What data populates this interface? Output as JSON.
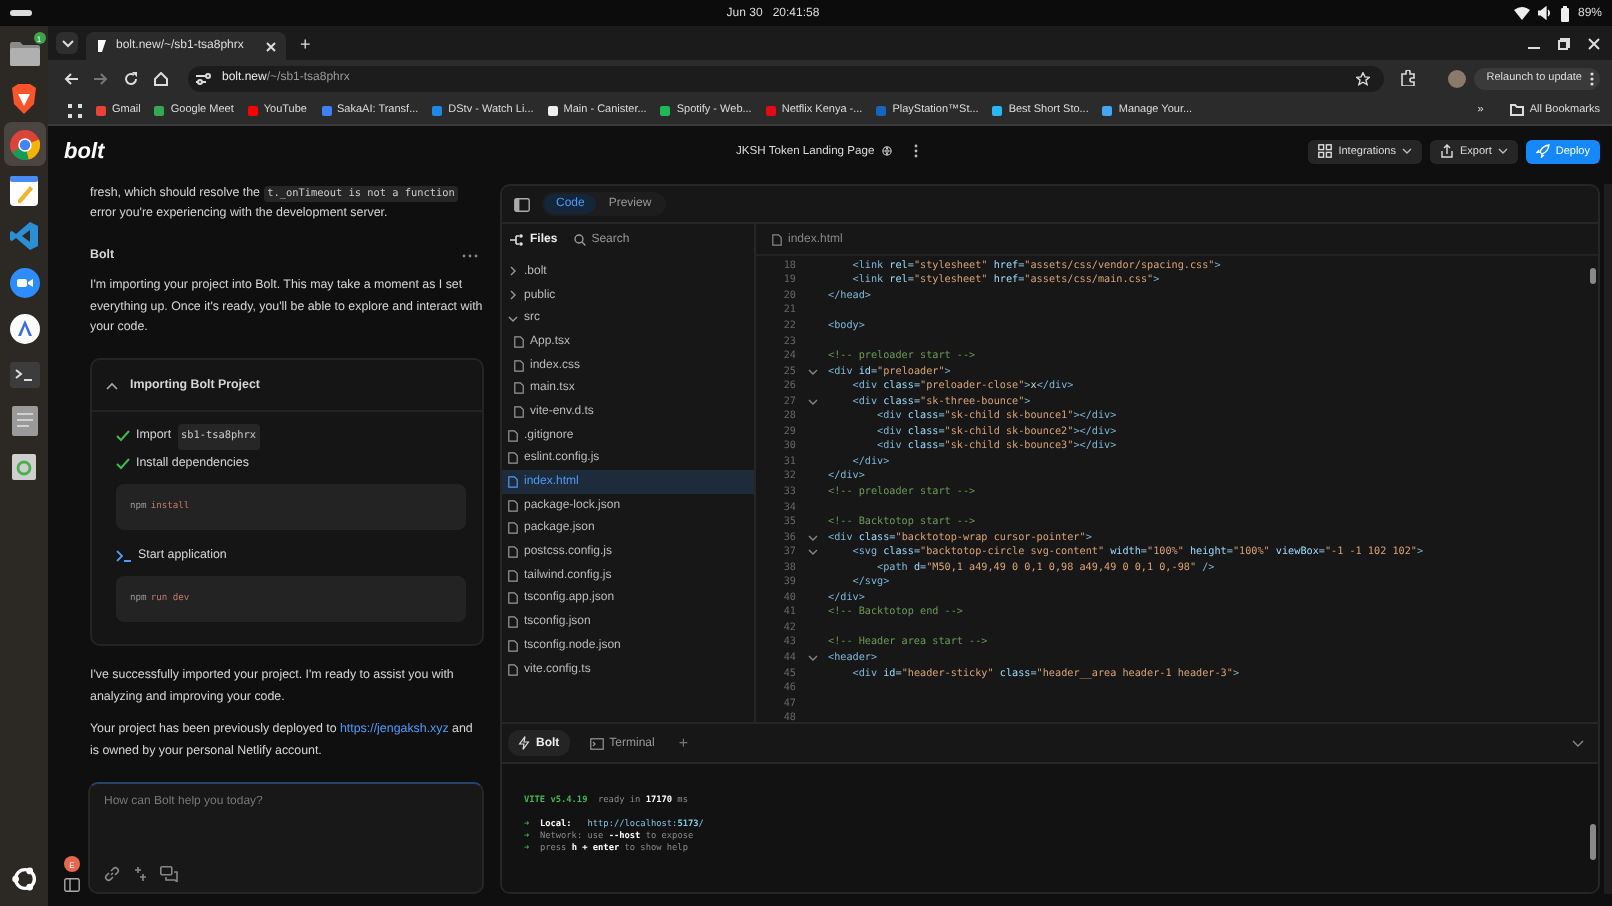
{
  "system_bar": {
    "date": "Jun 30",
    "time": "20:41:58",
    "battery": "89%"
  },
  "dock": {
    "items": [
      {
        "kind": "files",
        "badge": "1",
        "active": false
      },
      {
        "kind": "brave",
        "active": false
      },
      {
        "kind": "chrome",
        "active": true
      },
      {
        "kind": "notes",
        "active": false
      },
      {
        "kind": "vscode",
        "active": false
      },
      {
        "kind": "zoom",
        "active": false
      },
      {
        "kind": "appstore",
        "active": false
      },
      {
        "kind": "terminal",
        "active": false
      },
      {
        "kind": "editor",
        "active": false
      },
      {
        "kind": "trash",
        "active": false
      }
    ]
  },
  "browser": {
    "tab": {
      "title": "bolt.new/~/sb1-tsa8phrx"
    },
    "new_tab": "+",
    "url": {
      "host": "bolt.new",
      "path": "/~/sb1-tsa8phrx"
    },
    "relaunch": "Relaunch to update",
    "bookmarks": [
      {
        "label": "Gmail"
      },
      {
        "label": "Google Meet"
      },
      {
        "label": "YouTube"
      },
      {
        "label": "SakaAI: Transf..."
      },
      {
        "label": "DStv - Watch Li..."
      },
      {
        "label": "Main - Canister..."
      },
      {
        "label": "Spotify - Web..."
      },
      {
        "label": "Netflix Kenya -..."
      },
      {
        "label": "PlayStation™St..."
      },
      {
        "label": "Best Short Sto..."
      },
      {
        "label": "Manage Your..."
      }
    ],
    "more": "»",
    "all_bookmarks": "All Bookmarks"
  },
  "app": {
    "logo": "bolt",
    "project_title": "JKSH Token Landing Page",
    "actions": [
      {
        "label": "Integrations",
        "kind": "integrations"
      },
      {
        "label": "Export",
        "kind": "export"
      },
      {
        "label": "Deploy",
        "kind": "deploy"
      }
    ]
  },
  "chat": {
    "intro": {
      "before": "fresh, which should resolve the",
      "code": "t._onTimeout is not a function",
      "after": "error you're experiencing with the development server."
    },
    "sender": "Bolt",
    "message": "I'm importing your project into Bolt. This may take a moment as I set everything up. Once it's ready, you'll be able to explore and interact with your code.",
    "card": {
      "title": "Importing Bolt Project",
      "expanded": true,
      "steps": [
        {
          "kind": "done",
          "label": "Import",
          "code": "sb1-tsa8phrx"
        },
        {
          "kind": "done",
          "label": "Install dependencies",
          "command": {
            "program": "npm",
            "args": "install"
          }
        },
        {
          "kind": "command",
          "label": "Start application",
          "command": {
            "program": "npm",
            "args": "run dev"
          }
        }
      ]
    },
    "summary": "I've successfully imported your project. I'm ready to assist you with analyzing and improving your code.",
    "deployed": {
      "before": "Your project has been previously deployed to",
      "link": "https://jengaksh.xyz",
      "after": "and is owned by your personal Netlify account."
    },
    "input": {
      "placeholder": "How can Bolt help you today?"
    },
    "user_avatar": "E"
  },
  "workbench": {
    "views": [
      {
        "label": "Code",
        "selected": true
      },
      {
        "label": "Preview",
        "selected": false
      }
    ],
    "files_tab": "Files",
    "search_tab": "Search",
    "tree": [
      {
        "name": ".bolt",
        "kind": "folder",
        "expanded": false,
        "selected": false
      },
      {
        "name": "public",
        "kind": "folder",
        "expanded": false,
        "selected": false
      },
      {
        "name": "src",
        "kind": "folder",
        "expanded": true,
        "selected": false,
        "children": [
          {
            "name": "App.tsx",
            "kind": "file",
            "selected": false
          },
          {
            "name": "index.css",
            "kind": "file",
            "selected": false
          },
          {
            "name": "main.tsx",
            "kind": "file",
            "selected": false
          },
          {
            "name": "vite-env.d.ts",
            "kind": "file",
            "selected": false
          }
        ]
      },
      {
        "name": ".gitignore",
        "kind": "file",
        "selected": false
      },
      {
        "name": "eslint.config.js",
        "kind": "file",
        "selected": false
      },
      {
        "name": "index.html",
        "kind": "file",
        "selected": true
      },
      {
        "name": "package-lock.json",
        "kind": "file",
        "selected": false
      },
      {
        "name": "package.json",
        "kind": "file",
        "selected": false
      },
      {
        "name": "postcss.config.js",
        "kind": "file",
        "selected": false
      },
      {
        "name": "tailwind.config.js",
        "kind": "file",
        "selected": false
      },
      {
        "name": "tsconfig.app.json",
        "kind": "file",
        "selected": false
      },
      {
        "name": "tsconfig.json",
        "kind": "file",
        "selected": false
      },
      {
        "name": "tsconfig.node.json",
        "kind": "file",
        "selected": false
      },
      {
        "name": "vite.config.ts",
        "kind": "file",
        "selected": false
      }
    ],
    "editor": {
      "file": "index.html",
      "lines": [
        {
          "n": "18",
          "fold": false,
          "tokens": [
            {
              "kind": "tag",
              "text": "    <link "
            },
            {
              "kind": "attr",
              "text": "rel="
            },
            {
              "kind": "str",
              "text": "\"stylesheet\""
            },
            {
              "kind": "attr",
              "text": " href="
            },
            {
              "kind": "str",
              "text": "\"assets/css/vendor/spacing.css\""
            },
            {
              "kind": "tag",
              "text": ">"
            }
          ]
        },
        {
          "n": "19",
          "fold": false,
          "tokens": [
            {
              "kind": "tag",
              "text": "    <link "
            },
            {
              "kind": "attr",
              "text": "rel="
            },
            {
              "kind": "str",
              "text": "\"stylesheet\""
            },
            {
              "kind": "attr",
              "text": " href="
            },
            {
              "kind": "str",
              "text": "\"assets/css/main.css\""
            },
            {
              "kind": "tag",
              "text": ">"
            }
          ]
        },
        {
          "n": "20",
          "fold": false,
          "tokens": [
            {
              "kind": "tag",
              "text": "</head>"
            }
          ]
        },
        {
          "n": "21",
          "fold": false
        },
        {
          "n": "22",
          "fold": false,
          "tokens": [
            {
              "kind": "tag",
              "text": "<body>"
            }
          ]
        },
        {
          "n": "23",
          "fold": false
        },
        {
          "n": "24",
          "fold": false,
          "tokens": [
            {
              "kind": "comment",
              "text": "<!-- preloader start -->"
            }
          ]
        },
        {
          "n": "25",
          "fold": true,
          "tokens": [
            {
              "kind": "tag",
              "text": "<div "
            },
            {
              "kind": "attr",
              "text": "id="
            },
            {
              "kind": "str",
              "text": "\"preloader\""
            },
            {
              "kind": "tag",
              "text": ">"
            }
          ]
        },
        {
          "n": "26",
          "fold": false,
          "tokens": [
            {
              "kind": "tag",
              "text": "    <div "
            },
            {
              "kind": "attr",
              "text": "class="
            },
            {
              "kind": "str",
              "text": "\"preloader-close\""
            },
            {
              "kind": "tag",
              "text": ">"
            },
            {
              "kind": "text",
              "text": "x"
            },
            {
              "kind": "tag",
              "text": "</div>"
            }
          ]
        },
        {
          "n": "27",
          "fold": true,
          "tokens": [
            {
              "kind": "tag",
              "text": "    <div "
            },
            {
              "kind": "attr",
              "text": "class="
            },
            {
              "kind": "str",
              "text": "\"sk-three-bounce\""
            },
            {
              "kind": "tag",
              "text": ">"
            }
          ]
        },
        {
          "n": "28",
          "fold": false,
          "tokens": [
            {
              "kind": "tag",
              "text": "        <div "
            },
            {
              "kind": "attr",
              "text": "class="
            },
            {
              "kind": "str",
              "text": "\"sk-child sk-bounce1\""
            },
            {
              "kind": "tag",
              "text": "></div>"
            }
          ]
        },
        {
          "n": "29",
          "fold": false,
          "tokens": [
            {
              "kind": "tag",
              "text": "        <div "
            },
            {
              "kind": "attr",
              "text": "class="
            },
            {
              "kind": "str",
              "text": "\"sk-child sk-bounce2\""
            },
            {
              "kind": "tag",
              "text": "></div>"
            }
          ]
        },
        {
          "n": "30",
          "fold": false,
          "tokens": [
            {
              "kind": "tag",
              "text": "        <div "
            },
            {
              "kind": "attr",
              "text": "class="
            },
            {
              "kind": "str",
              "text": "\"sk-child sk-bounce3\""
            },
            {
              "kind": "tag",
              "text": "></div>"
            }
          ]
        },
        {
          "n": "31",
          "fold": false,
          "tokens": [
            {
              "kind": "tag",
              "text": "    </div>"
            }
          ]
        },
        {
          "n": "32",
          "fold": false,
          "tokens": [
            {
              "kind": "tag",
              "text": "</div>"
            }
          ]
        },
        {
          "n": "33",
          "fold": false,
          "tokens": [
            {
              "kind": "comment",
              "text": "<!-- preloader start -->"
            }
          ]
        },
        {
          "n": "34",
          "fold": false
        },
        {
          "n": "35",
          "fold": false,
          "tokens": [
            {
              "kind": "comment",
              "text": "<!-- Backtotop start -->"
            }
          ]
        },
        {
          "n": "36",
          "fold": true,
          "tokens": [
            {
              "kind": "tag",
              "text": "<div "
            },
            {
              "kind": "attr",
              "text": "class="
            },
            {
              "kind": "str",
              "text": "\"backtotop-wrap cursor-pointer\""
            },
            {
              "kind": "tag",
              "text": ">"
            }
          ]
        },
        {
          "n": "37",
          "fold": true,
          "tokens": [
            {
              "kind": "tag",
              "text": "    <svg "
            },
            {
              "kind": "attr",
              "text": "class="
            },
            {
              "kind": "str",
              "text": "\"backtotop-circle svg-content\""
            },
            {
              "kind": "attr",
              "text": " width="
            },
            {
              "kind": "str",
              "text": "\"100%\""
            },
            {
              "kind": "attr",
              "text": " height="
            },
            {
              "kind": "str",
              "text": "\"100%\""
            },
            {
              "kind": "attr",
              "text": " viewBox="
            },
            {
              "kind": "str",
              "text": "\"-1 -1 102 102\""
            },
            {
              "kind": "tag",
              "text": ">"
            }
          ]
        },
        {
          "n": "38",
          "fold": false,
          "tokens": [
            {
              "kind": "tag",
              "text": "        <path "
            },
            {
              "kind": "attr",
              "text": "d="
            },
            {
              "kind": "str",
              "text": "\"M50,1 a49,49 0 0,1 0,98 a49,49 0 0,1 0,-98\""
            },
            {
              "kind": "tag",
              "text": " />"
            }
          ]
        },
        {
          "n": "39",
          "fold": false,
          "tokens": [
            {
              "kind": "tag",
              "text": "    </svg>"
            }
          ]
        },
        {
          "n": "40",
          "fold": false,
          "tokens": [
            {
              "kind": "tag",
              "text": "</div>"
            }
          ]
        },
        {
          "n": "41",
          "fold": false,
          "tokens": [
            {
              "kind": "comment",
              "text": "<!-- Backtotop end -->"
            }
          ]
        },
        {
          "n": "42",
          "fold": false
        },
        {
          "n": "43",
          "fold": false,
          "tokens": [
            {
              "kind": "comment",
              "text": "<!-- Header area start -->"
            }
          ]
        },
        {
          "n": "44",
          "fold": true,
          "tokens": [
            {
              "kind": "tag",
              "text": "<header>"
            }
          ]
        },
        {
          "n": "45",
          "fold": false,
          "tokens": [
            {
              "kind": "tag",
              "text": "    <div "
            },
            {
              "kind": "attr",
              "text": "id="
            },
            {
              "kind": "str",
              "text": "\"header-sticky\""
            },
            {
              "kind": "attr",
              "text": " class="
            },
            {
              "kind": "str",
              "text": "\"header__area header-1 header-3\""
            },
            {
              "kind": "tag",
              "text": ">"
            }
          ]
        },
        {
          "n": "46",
          "fold": false
        },
        {
          "n": "47",
          "fold": false
        },
        {
          "n": "48",
          "fold": false
        }
      ]
    },
    "terminal": {
      "tabs": [
        {
          "label": "Bolt",
          "kind": "bolt",
          "selected": true
        },
        {
          "label": "Terminal",
          "kind": "terminal",
          "selected": false
        }
      ],
      "add": "+",
      "output": [
        [
          [
            {
              "kind": "vite",
              "text": "VITE v5.4.19"
            },
            {
              "kind": "dim",
              "text": "  ready in "
            },
            {
              "kind": "bold",
              "text": "17170"
            },
            {
              "kind": "dim",
              "text": " ms"
            }
          ]
        ],
        [
          [
            {
              "kind": "arrow",
              "text": "➜  "
            },
            {
              "kind": "bold",
              "text": "Local:"
            },
            {
              "kind": "link",
              "text": "   http://localhost:"
            },
            {
              "kind": "boldlink",
              "text": "5173"
            },
            {
              "kind": "link",
              "text": "/"
            }
          ],
          [
            {
              "kind": "arrow",
              "text": "➜  "
            },
            {
              "kind": "dim",
              "text": "Network: use "
            },
            {
              "kind": "bold",
              "text": "--host"
            },
            {
              "kind": "dim",
              "text": " to expose"
            }
          ],
          [
            {
              "kind": "arrow",
              "text": "➜  "
            },
            {
              "kind": "dim",
              "text": "press "
            },
            {
              "kind": "bold",
              "text": "h + enter"
            },
            {
              "kind": "dim",
              "text": " to show help"
            }
          ]
        ]
      ]
    }
  }
}
